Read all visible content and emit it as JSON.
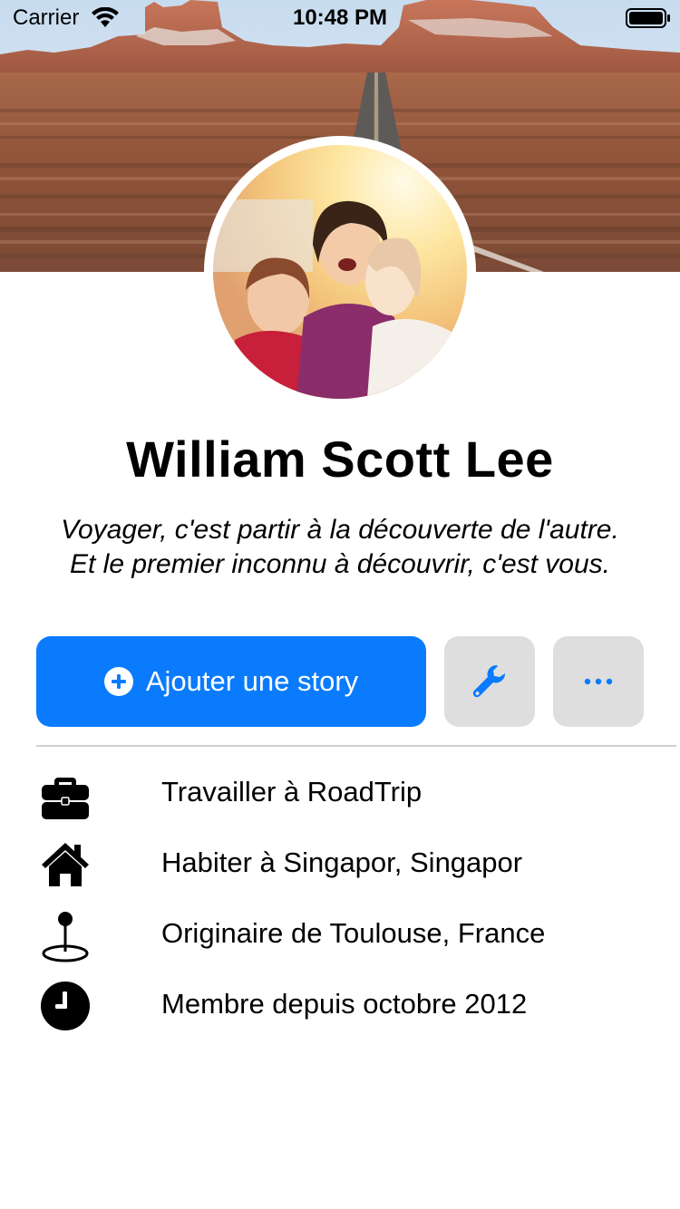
{
  "status_bar": {
    "carrier": "Carrier",
    "time": "10:48 PM"
  },
  "profile": {
    "name": "William Scott Lee",
    "bio": "Voyager, c'est partir à la découverte de l'autre. Et le premier inconnu à découvrir, c'est vous."
  },
  "actions": {
    "story_label": "Ajouter une story",
    "story_icon": "plus-circle-icon",
    "edit_icon": "wrench-icon",
    "more_icon": "ellipsis-icon"
  },
  "info": {
    "items": [
      {
        "icon": "briefcase-icon",
        "text": "Travailler à RoadTrip"
      },
      {
        "icon": "home-icon",
        "text": "Habiter à Singapor, Singapor"
      },
      {
        "icon": "location-pin-icon",
        "text": "Originaire de Toulouse, France"
      },
      {
        "icon": "clock-icon",
        "text": "Membre depuis octobre 2012"
      }
    ]
  },
  "colors": {
    "accent": "#0a7bfd",
    "button_gray": "#dedede",
    "divider": "#d0d0d0"
  }
}
